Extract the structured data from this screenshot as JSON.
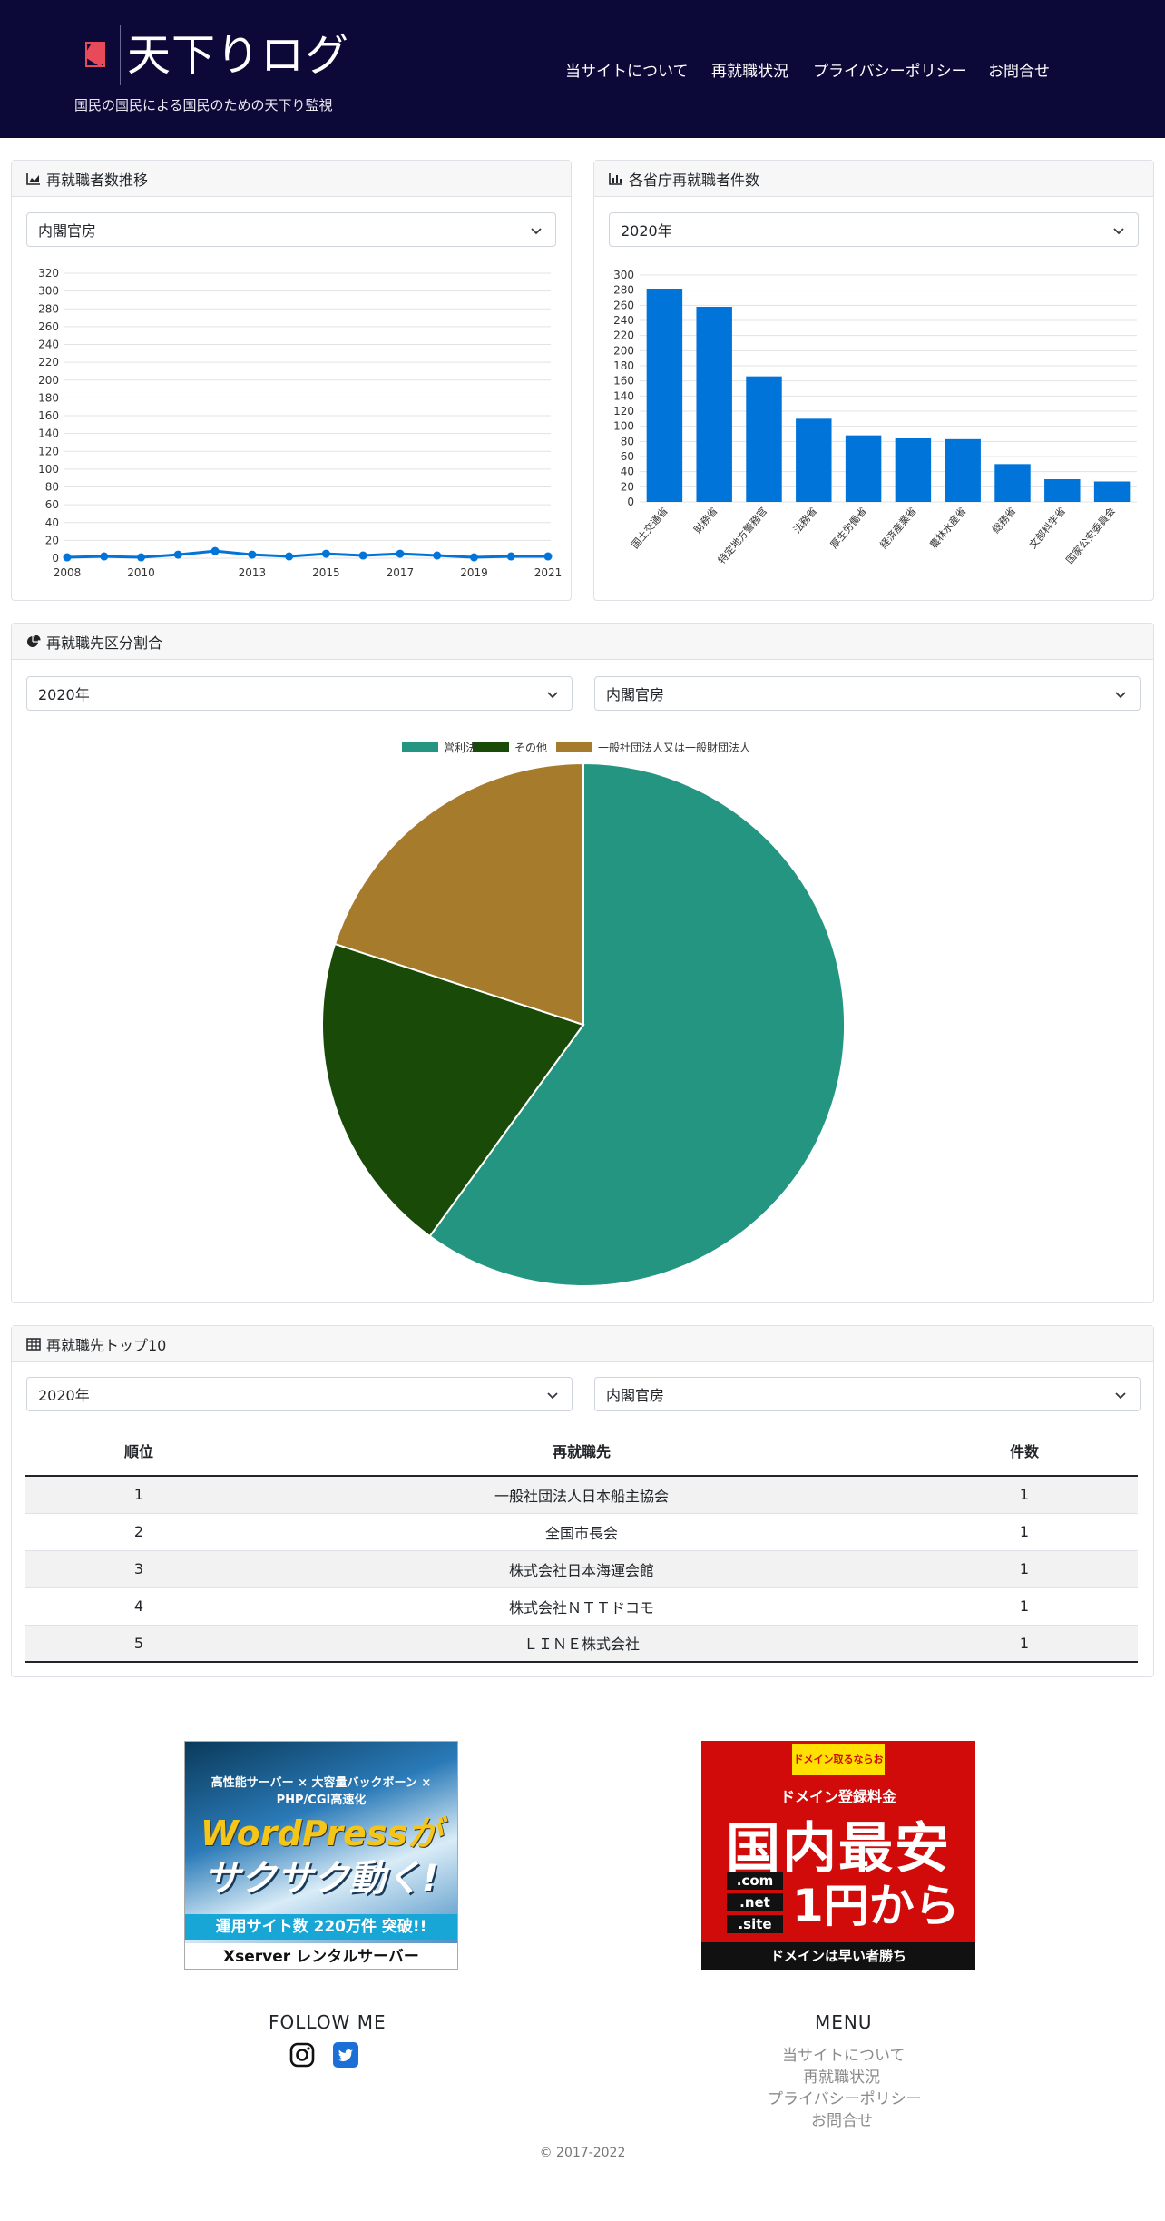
{
  "header": {
    "title": "天下りログ",
    "tagline": "国民の国民による国民のための天下り監視",
    "nav": [
      "当サイトについて",
      "再就職状況",
      "プライバシーポリシー",
      "お問合せ"
    ]
  },
  "trend_card": {
    "title": "再就職者数推移",
    "select_value": "内閣官房"
  },
  "ministry_card": {
    "title": "各省庁再就職者件数",
    "select_value": "2020年"
  },
  "pie_card": {
    "title": "再就職先区分割合",
    "year_select": "2020年",
    "org_select": "内閣官房"
  },
  "top10_card": {
    "title": "再就職先トップ10",
    "year_select": "2020年",
    "org_select": "内閣官房",
    "columns": [
      "順位",
      "再就職先",
      "件数"
    ],
    "rows": [
      [
        "1",
        "一般社団法人日本船主協会",
        "1"
      ],
      [
        "2",
        "全国市長会",
        "1"
      ],
      [
        "3",
        "株式会社日本海運会館",
        "1"
      ],
      [
        "4",
        "株式会社ＮＴＴドコモ",
        "1"
      ],
      [
        "5",
        "ＬＩＮＥ株式会社",
        "1"
      ]
    ]
  },
  "ads": {
    "xserver": [
      "高性能サーバー × 大容量バックボーン × PHP/CGI高速化",
      "WordPressが",
      "サクサク動く!",
      "運用サイト数 220万件 突破!!",
      "Xserver レンタルサーバー"
    ],
    "onamae": [
      "ドメイン取るならお名前.com",
      "ドメイン登録料金",
      "国内最安",
      ".com",
      ".net",
      ".site",
      "1円から",
      "ドメインは早い者勝ち"
    ]
  },
  "footer": {
    "follow_title": "FOLLOW ME",
    "menu_title": "MENU",
    "menu": [
      "当サイトについて",
      "再就職状況",
      "プライバシーポリシー",
      "お問合せ"
    ],
    "copyright": "© 2017-2022"
  },
  "colors": {
    "header_bg": "#0c0838",
    "bar": "#0074d9",
    "pie_profit": "#239580",
    "pie_other": "#1a4a08",
    "pie_association": "#a67c2c"
  },
  "chart_data": [
    {
      "type": "line",
      "x": [
        "2008",
        "2009",
        "2010",
        "2011",
        "2012",
        "2013",
        "2014",
        "2015",
        "2016",
        "2017",
        "2018",
        "2019",
        "2020",
        "2021"
      ],
      "x_tick_labels": [
        "2008",
        "2010",
        "2013",
        "2015",
        "2017",
        "2019",
        "2021"
      ],
      "values": [
        1,
        2,
        1,
        4,
        8,
        4,
        2,
        5,
        3,
        5,
        3,
        1,
        2,
        2
      ],
      "ylim": [
        0,
        320
      ],
      "y_ticks": [
        0,
        20,
        40,
        60,
        80,
        100,
        120,
        140,
        160,
        180,
        200,
        220,
        240,
        260,
        280,
        300,
        320
      ],
      "grid": true
    },
    {
      "type": "bar",
      "categories": [
        "国土交通省",
        "財務省",
        "特定地方警務官",
        "法務省",
        "厚生労働省",
        "経済産業省",
        "農林水産省",
        "総務省",
        "文部科学省",
        "国家公安委員会"
      ],
      "values": [
        282,
        258,
        166,
        110,
        88,
        84,
        83,
        50,
        30,
        27
      ],
      "ylim": [
        0,
        300
      ],
      "y_ticks": [
        0,
        20,
        40,
        60,
        80,
        100,
        120,
        140,
        160,
        180,
        200,
        220,
        240,
        260,
        280,
        300
      ],
      "grid": true
    },
    {
      "type": "pie",
      "legend": [
        "営利法人",
        "その他",
        "一般社団法人又は一般財団法人"
      ],
      "values": [
        60,
        20,
        20
      ],
      "legend_position": "top"
    }
  ]
}
